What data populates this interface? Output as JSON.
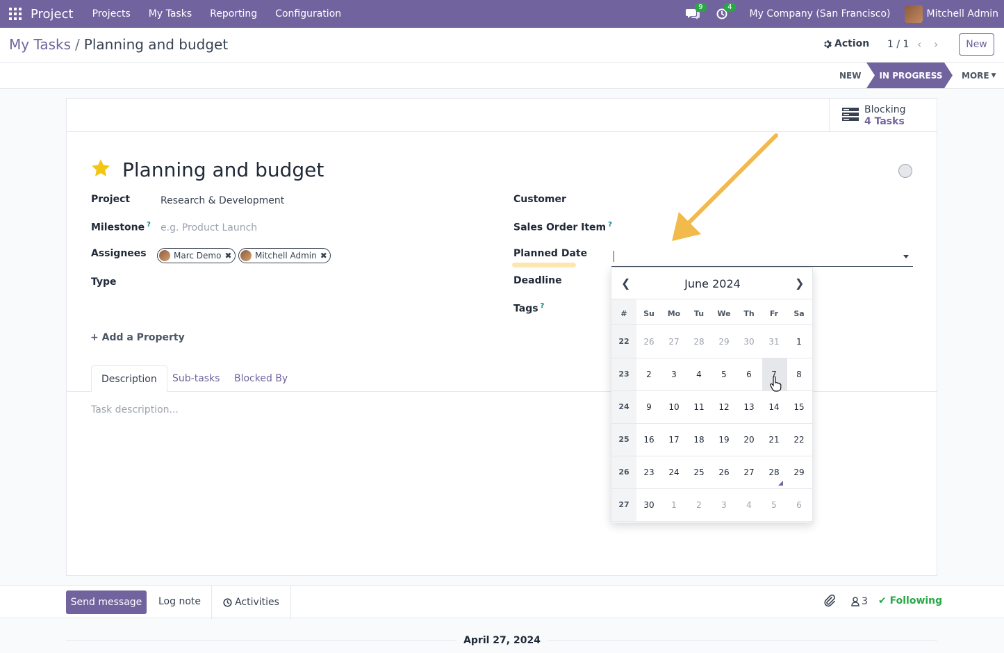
{
  "navbar": {
    "brand": "Project",
    "menus": [
      "Projects",
      "My Tasks",
      "Reporting",
      "Configuration"
    ],
    "messages_count": "9",
    "activities_count": "4",
    "company": "My Company (San Francisco)",
    "user": "Mitchell Admin"
  },
  "control": {
    "breadcrumb_parent": "My Tasks",
    "breadcrumb_sep": "/",
    "breadcrumb_current": "Planning and budget",
    "action_label": "Action",
    "pager": "1 / 1",
    "new_label": "New"
  },
  "statusbar": {
    "stages": [
      "NEW",
      "IN PROGRESS",
      "MORE"
    ],
    "active": "IN PROGRESS"
  },
  "form": {
    "blocking_label": "Blocking",
    "blocking_value": "4 Tasks",
    "title": "Planning and budget",
    "project_label": "Project",
    "project_value": "Research & Development",
    "milestone_label": "Milestone",
    "milestone_placeholder": "e.g. Product Launch",
    "assignees_label": "Assignees",
    "assignees": [
      "Marc Demo",
      "Mitchell Admin"
    ],
    "type_label": "Type",
    "customer_label": "Customer",
    "sales_order_label": "Sales Order Item",
    "planned_date_label": "Planned Date",
    "deadline_label": "Deadline",
    "tags_label": "Tags",
    "help_mark": "?",
    "add_property": "Add a Property",
    "tabs": [
      "Description",
      "Sub-tasks",
      "Blocked By"
    ],
    "description_placeholder": "Task description..."
  },
  "calendar": {
    "month_title": "June 2024",
    "week_header": "#",
    "day_names": [
      "Su",
      "Mo",
      "Tu",
      "We",
      "Th",
      "Fr",
      "Sa"
    ],
    "weeks": [
      {
        "num": "22",
        "days": [
          "26",
          "27",
          "28",
          "29",
          "30",
          "31",
          "1"
        ]
      },
      {
        "num": "23",
        "days": [
          "2",
          "3",
          "4",
          "5",
          "6",
          "7",
          "8"
        ]
      },
      {
        "num": "24",
        "days": [
          "9",
          "10",
          "11",
          "12",
          "13",
          "14",
          "15"
        ]
      },
      {
        "num": "25",
        "days": [
          "16",
          "17",
          "18",
          "19",
          "20",
          "21",
          "22"
        ]
      },
      {
        "num": "26",
        "days": [
          "23",
          "24",
          "25",
          "26",
          "27",
          "28",
          "29"
        ]
      },
      {
        "num": "27",
        "days": [
          "30",
          "1",
          "2",
          "3",
          "4",
          "5",
          "6"
        ]
      }
    ],
    "hovered_day": "7",
    "today": "28"
  },
  "chatter": {
    "send_message": "Send message",
    "log_note": "Log note",
    "activities": "Activities",
    "followers_count": "3",
    "following": "Following",
    "date_separator": "April 27, 2024"
  },
  "colors": {
    "brand": "#71639e",
    "success": "#28a745",
    "annotation_arrow": "#f2b94b"
  }
}
